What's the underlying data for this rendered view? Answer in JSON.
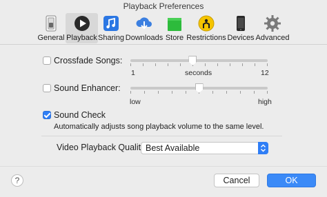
{
  "window": {
    "title": "Playback Preferences"
  },
  "toolbar": {
    "items": [
      {
        "label": "General",
        "icon": "general-switch-icon"
      },
      {
        "label": "Playback",
        "icon": "play-icon",
        "selected": true
      },
      {
        "label": "Sharing",
        "icon": "music-note-icon"
      },
      {
        "label": "Downloads",
        "icon": "cloud-download-icon"
      },
      {
        "label": "Store",
        "icon": "store-bag-icon"
      },
      {
        "label": "Restrictions",
        "icon": "restrictions-icon"
      },
      {
        "label": "Devices",
        "icon": "phone-icon"
      },
      {
        "label": "Advanced",
        "icon": "gear-icon"
      }
    ]
  },
  "crossfade": {
    "label": "Crossfade Songs:",
    "checked": false,
    "min_label": "1",
    "mid_label": "seconds",
    "max_label": "12",
    "value": 6
  },
  "enhancer": {
    "label": "Sound Enhancer:",
    "checked": false,
    "min_label": "low",
    "max_label": "high",
    "level": 0.5
  },
  "soundcheck": {
    "label": "Sound Check",
    "checked": true,
    "description": "Automatically adjusts song playback volume to the same level."
  },
  "video_quality": {
    "label": "Video Playback Quality:",
    "value": "Best Available"
  },
  "buttons": {
    "help": "?",
    "cancel": "Cancel",
    "ok": "OK"
  },
  "colors": {
    "accent": "#2f7ef6",
    "window_bg": "#ececec"
  }
}
